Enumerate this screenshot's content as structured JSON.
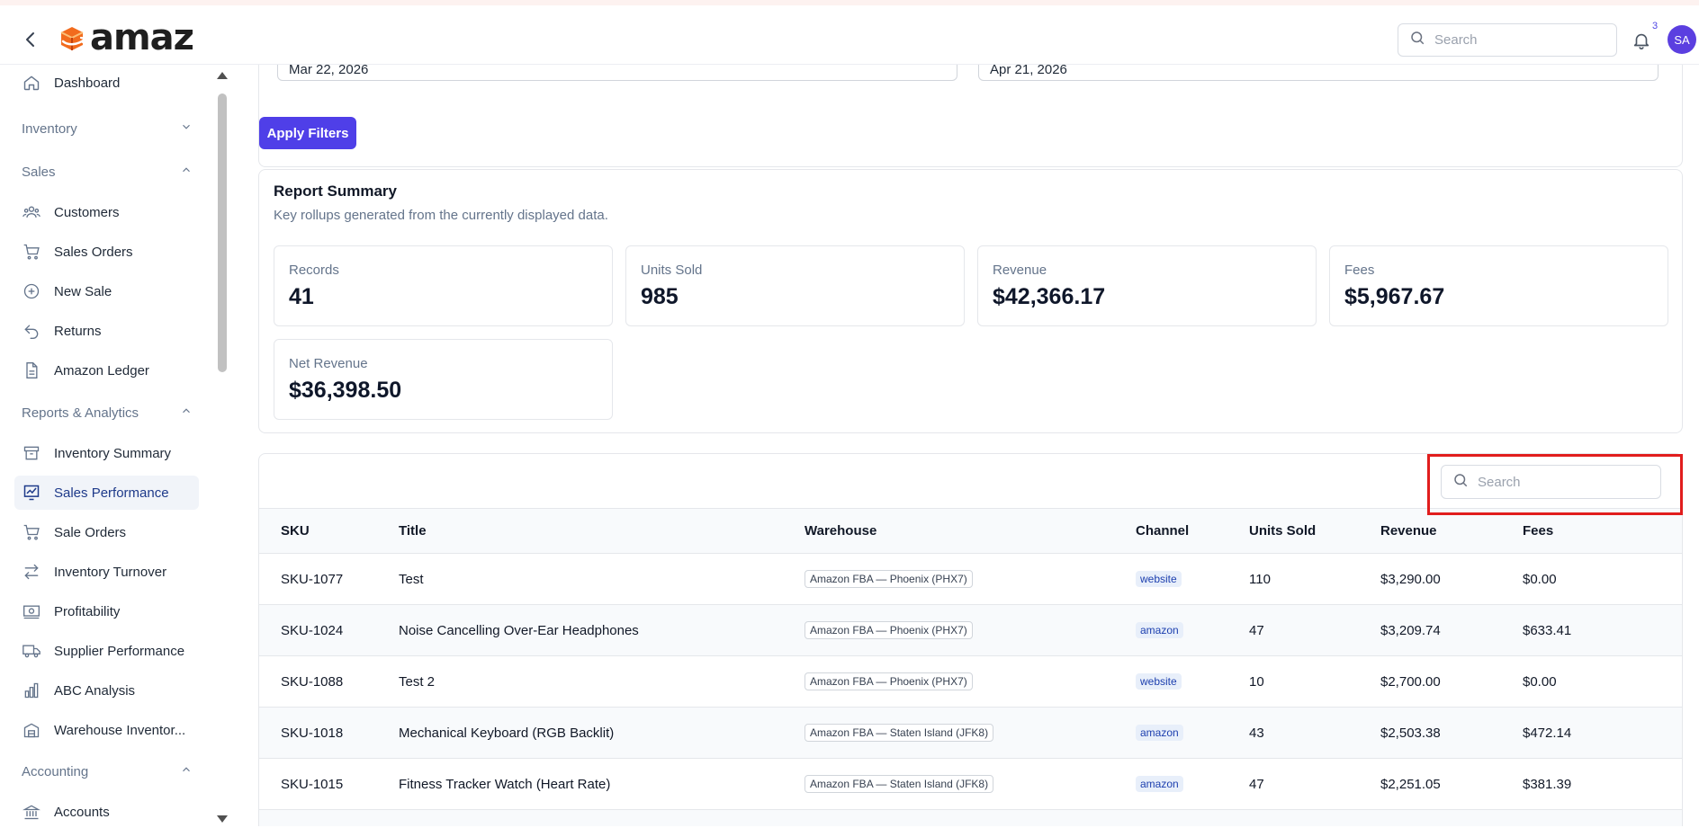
{
  "header": {
    "logo_text": "amaz",
    "search_placeholder": "Search",
    "notification_count": "3",
    "avatar_initials": "SA"
  },
  "sidebar": {
    "items": [
      {
        "label": "Dashboard",
        "icon": "home-icon",
        "type": "item"
      },
      {
        "label": "Inventory",
        "type": "section",
        "state": "collapsed"
      },
      {
        "label": "Sales",
        "type": "section",
        "state": "expanded"
      },
      {
        "label": "Customers",
        "icon": "users-icon",
        "type": "item"
      },
      {
        "label": "Sales Orders",
        "icon": "cart-icon",
        "type": "item"
      },
      {
        "label": "New Sale",
        "icon": "plus-circle-icon",
        "type": "item"
      },
      {
        "label": "Returns",
        "icon": "undo-icon",
        "type": "item"
      },
      {
        "label": "Amazon Ledger",
        "icon": "document-icon",
        "type": "item"
      },
      {
        "label": "Reports & Analytics",
        "type": "section",
        "state": "expanded"
      },
      {
        "label": "Inventory Summary",
        "icon": "archive-icon",
        "type": "item"
      },
      {
        "label": "Sales Performance",
        "icon": "chart-line-icon",
        "type": "item",
        "active": true
      },
      {
        "label": "Sale Orders",
        "icon": "cart-icon",
        "type": "item"
      },
      {
        "label": "Inventory Turnover",
        "icon": "arrows-swap-icon",
        "type": "item"
      },
      {
        "label": "Profitability",
        "icon": "cash-icon",
        "type": "item"
      },
      {
        "label": "Supplier Performance",
        "icon": "truck-icon",
        "type": "item"
      },
      {
        "label": "ABC Analysis",
        "icon": "bar-chart-icon",
        "type": "item"
      },
      {
        "label": "Warehouse Inventor...",
        "icon": "warehouse-icon",
        "type": "item"
      },
      {
        "label": "Accounting",
        "type": "section",
        "state": "expanded"
      },
      {
        "label": "Accounts",
        "icon": "bank-icon",
        "type": "item"
      }
    ]
  },
  "filters": {
    "start_date": "Mar 22, 2026",
    "end_date": "Apr 21, 2026",
    "apply_label": "Apply Filters"
  },
  "summary": {
    "title": "Report Summary",
    "subtitle": "Key rollups generated from the currently displayed data.",
    "stats": [
      {
        "label": "Records",
        "value": "41"
      },
      {
        "label": "Units Sold",
        "value": "985"
      },
      {
        "label": "Revenue",
        "value": "$42,366.17"
      },
      {
        "label": "Fees",
        "value": "$5,967.67"
      },
      {
        "label": "Net Revenue",
        "value": "$36,398.50"
      }
    ]
  },
  "table": {
    "search_placeholder": "Search",
    "columns": [
      "SKU",
      "Title",
      "Warehouse",
      "Channel",
      "Units Sold",
      "Revenue",
      "Fees"
    ],
    "rows": [
      {
        "sku": "SKU-1077",
        "title": "Test",
        "warehouse": "Amazon FBA — Phoenix (PHX7)",
        "channel": "website",
        "units": "110",
        "revenue": "$3,290.00",
        "fees": "$0.00"
      },
      {
        "sku": "SKU-1024",
        "title": "Noise Cancelling Over-Ear Headphones",
        "warehouse": "Amazon FBA — Phoenix (PHX7)",
        "channel": "amazon",
        "units": "47",
        "revenue": "$3,209.74",
        "fees": "$633.41"
      },
      {
        "sku": "SKU-1088",
        "title": "Test 2",
        "warehouse": "Amazon FBA — Phoenix (PHX7)",
        "channel": "website",
        "units": "10",
        "revenue": "$2,700.00",
        "fees": "$0.00"
      },
      {
        "sku": "SKU-1018",
        "title": "Mechanical Keyboard (RGB Backlit)",
        "warehouse": "Amazon FBA — Staten Island (JFK8)",
        "channel": "amazon",
        "units": "43",
        "revenue": "$2,503.38",
        "fees": "$472.14"
      },
      {
        "sku": "SKU-1015",
        "title": "Fitness Tracker Watch (Heart Rate)",
        "warehouse": "Amazon FBA — Staten Island (JFK8)",
        "channel": "amazon",
        "units": "47",
        "revenue": "$2,251.05",
        "fees": "$381.39"
      }
    ]
  },
  "colors": {
    "accent": "#4f3fe8",
    "highlight": "#e11d1d",
    "logo_orange": "#f26b1d"
  }
}
